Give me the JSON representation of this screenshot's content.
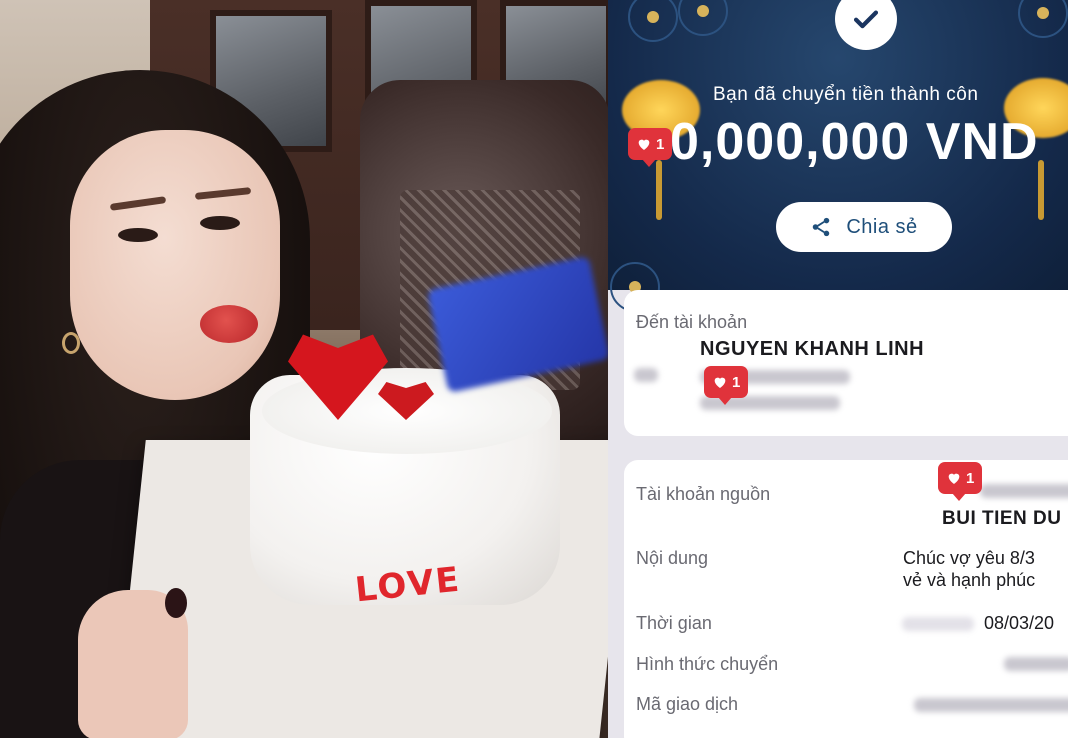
{
  "receipt": {
    "success_message": "Bạn đã chuyển tiền thành côn",
    "amount": "0,000,000 VND",
    "share_label": "Chia sẻ",
    "to_account_label": "Đến tài khoản",
    "recipient_name": "NGUYEN KHANH LINH",
    "source_account_label": "Tài khoản nguồn",
    "sender_name": "BUI TIEN DU",
    "content_label": "Nội dung",
    "content_value_line1": "Chúc vợ yêu 8/3",
    "content_value_line2": "vẻ và hạnh phúc",
    "time_label": "Thời gian",
    "time_value": "08/03/20",
    "transfer_type_label": "Hình thức chuyển",
    "transaction_id_label": "Mã giao dịch"
  },
  "reactions": [
    {
      "count": "1"
    },
    {
      "count": "1"
    },
    {
      "count": "1"
    }
  ],
  "photo": {
    "cake_text": "LOVE"
  },
  "colors": {
    "banner": "#14294a",
    "reaction": "#e0333b",
    "share_text": "#1f4f7a"
  },
  "icons": [
    "check-icon",
    "share-icon",
    "heart-icon"
  ]
}
